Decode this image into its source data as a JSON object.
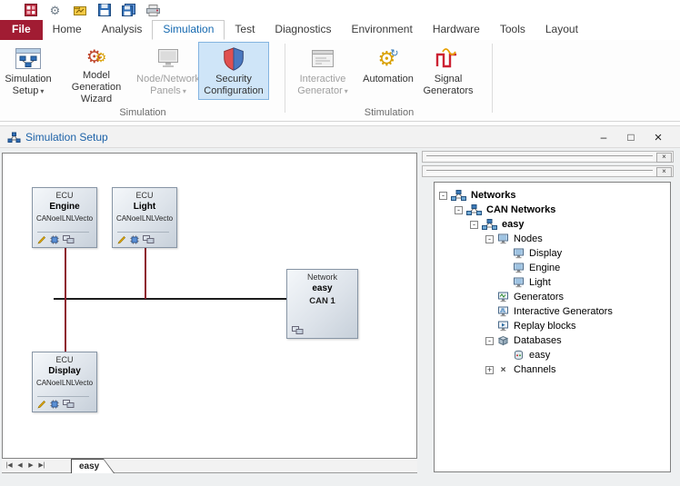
{
  "quick_access": {
    "icons": [
      {
        "name": "app-icon"
      },
      {
        "name": "options-gear-icon"
      },
      {
        "name": "measurement-setup-icon"
      },
      {
        "name": "save-icon"
      },
      {
        "name": "save-all-icon"
      },
      {
        "name": "print-icon"
      }
    ]
  },
  "ribbon": {
    "caret": "▾",
    "tabs": [
      "File",
      "Home",
      "Analysis",
      "Simulation",
      "Test",
      "Diagnostics",
      "Environment",
      "Hardware",
      "Tools",
      "Layout"
    ],
    "active_tab": "Simulation",
    "groups": [
      {
        "label": "Simulation",
        "buttons": [
          {
            "line1": "Simulation",
            "line2": "Setup",
            "dropdown": true,
            "state": "normal"
          },
          {
            "line1": "Model Generation",
            "line2": "Wizard",
            "dropdown": false,
            "state": "normal"
          },
          {
            "line1": "Node/Network",
            "line2": "Panels",
            "dropdown": true,
            "state": "disabled"
          },
          {
            "line1": "Security",
            "line2": "Configuration",
            "dropdown": false,
            "state": "selected"
          }
        ]
      },
      {
        "label": "Stimulation",
        "buttons": [
          {
            "line1": "Interactive",
            "line2": "Generator",
            "dropdown": true,
            "state": "disabled"
          },
          {
            "line1": "Automation",
            "line2": "",
            "dropdown": false,
            "state": "normal"
          },
          {
            "line1": "Signal",
            "line2": "Generators",
            "dropdown": false,
            "state": "normal"
          }
        ]
      }
    ]
  },
  "window": {
    "title": "Simulation Setup",
    "minimize": "–",
    "maximize": "□",
    "close": "×"
  },
  "canvas": {
    "blocks": {
      "engine": {
        "kind": "ECU",
        "name": "Engine",
        "model": "CANoeILNLVecto"
      },
      "light": {
        "kind": "ECU",
        "name": "Light",
        "model": "CANoeILNLVecto"
      },
      "display": {
        "kind": "ECU",
        "name": "Display",
        "model": "CANoeILNLVecto"
      },
      "network": {
        "kind": "Network",
        "name": "easy",
        "channel": "CAN 1"
      }
    },
    "bottom_tab": "easy",
    "nav": {
      "first": "|◀",
      "prev": "◀",
      "next": "▶",
      "last": "▶|"
    }
  },
  "panels": {
    "close_glyph": "×"
  },
  "tree": {
    "items": [
      {
        "label": "Networks",
        "expander": "-"
      },
      {
        "label": "CAN Networks",
        "expander": "-"
      },
      {
        "label": "easy",
        "expander": "-"
      },
      {
        "label": "Nodes",
        "expander": "-"
      },
      {
        "label": "Display"
      },
      {
        "label": "Engine"
      },
      {
        "label": "Light"
      },
      {
        "label": "Generators"
      },
      {
        "label": "Interactive Generators"
      },
      {
        "label": "Replay blocks"
      },
      {
        "label": "Databases",
        "expander": "-"
      },
      {
        "label": "easy"
      },
      {
        "label": "Channels",
        "expander": "+",
        "glyph": "×"
      }
    ]
  }
}
